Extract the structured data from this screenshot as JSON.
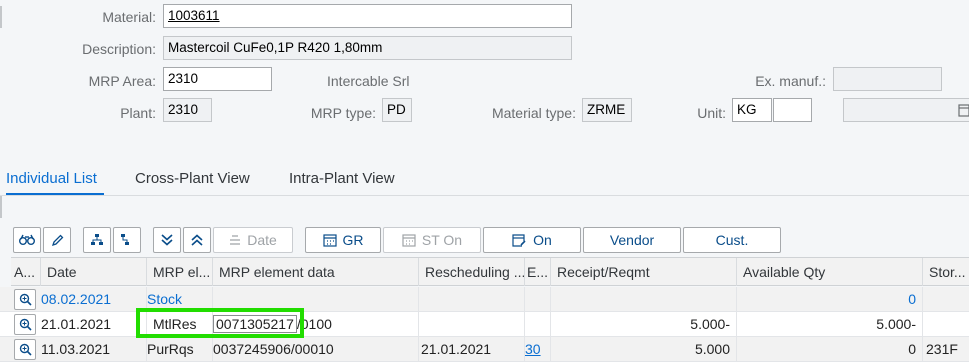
{
  "header": {
    "material_label": "Material:",
    "material_value": "1003611",
    "description_label": "Description:",
    "description_value": "Mastercoil CuFe0,1P R420 1,80mm",
    "mrp_area_label": "MRP Area:",
    "mrp_area_value": "2310",
    "mrp_area_text": "Intercable Srl",
    "ex_manuf_label": "Ex. manuf.:",
    "ex_manuf_value": "",
    "plant_label": "Plant:",
    "plant_value": "2310",
    "mrp_type_label": "MRP type:",
    "mrp_type_value": "PD",
    "material_type_label": "Material type:",
    "material_type_value": "ZRME",
    "unit_label": "Unit:",
    "unit_value": "KG"
  },
  "tabs": [
    {
      "label": "Individual List",
      "active": true
    },
    {
      "label": "Cross-Plant View",
      "active": false
    },
    {
      "label": "Intra-Plant View",
      "active": false
    }
  ],
  "toolbar": {
    "binoculars": "binoculars-icon",
    "pencil": "pencil-icon",
    "date_label": "Date",
    "gr_label": "GR",
    "st_on_label": "ST On",
    "on_label": "On",
    "vendor_label": "Vendor",
    "cust_label": "Cust."
  },
  "grid": {
    "columns": [
      "A...",
      "Date",
      "MRP el...",
      "MRP element data",
      "Rescheduling ...",
      "E...",
      "Receipt/Reqmt",
      "Available Qty",
      "Stor..."
    ],
    "rows": [
      {
        "date": "08.02.2021",
        "mrp_el": "Stock",
        "element_data": "",
        "rescheduling": "",
        "e": "",
        "receipt": "",
        "available": "0",
        "stor": ""
      },
      {
        "date": "21.01.2021",
        "mrp_el": "MtlRes",
        "element_data": "0071305217",
        "element_data_suffix": "/0100",
        "rescheduling": "",
        "e": "",
        "receipt": "5.000-",
        "available": "5.000-",
        "stor": ""
      },
      {
        "date": "11.03.2021",
        "mrp_el": "PurRqs",
        "element_data": "0037245906/00010",
        "rescheduling": "21.01.2021",
        "e": "30",
        "receipt": "5.000",
        "available": "0",
        "stor": "231F"
      }
    ]
  },
  "colors": {
    "accent": "#0a6ed1",
    "highlight": "#22dd00"
  }
}
